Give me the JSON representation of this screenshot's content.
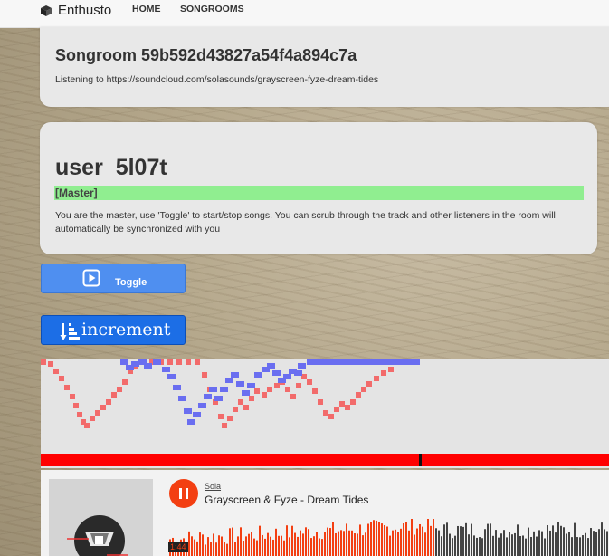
{
  "navbar": {
    "brand": "Enthusto",
    "links": [
      "HOME",
      "SONGROOMS"
    ]
  },
  "songroom": {
    "title": "Songroom 59b592d43827a54f4a894c7a",
    "listening": "Listening to https://soundcloud.com/solasounds/grayscreen-fyze-dream-tides"
  },
  "user": {
    "name": "user_5l07t",
    "role_label": "[Master]",
    "description": "You are the master, use 'Toggle' to start/stop songs. You can scrub through the track and other listeners in the room will automatically be synchronized with you"
  },
  "controls": {
    "toggle_label": "Toggle",
    "increment_label": "increment"
  },
  "player": {
    "uploader": "Sola",
    "track_title": "Grayscreen & Fyze - Dream Tides",
    "elapsed": "1:44",
    "progress_fraction": 0.6
  },
  "colors": {
    "accent_blue": "#4f8ff0",
    "increment_blue": "#1c6ee6",
    "master_green": "#90ee90",
    "viz_red": "#f26b6b",
    "viz_blue": "#6a6ef0",
    "soundcloud_orange": "#f33f12"
  }
}
